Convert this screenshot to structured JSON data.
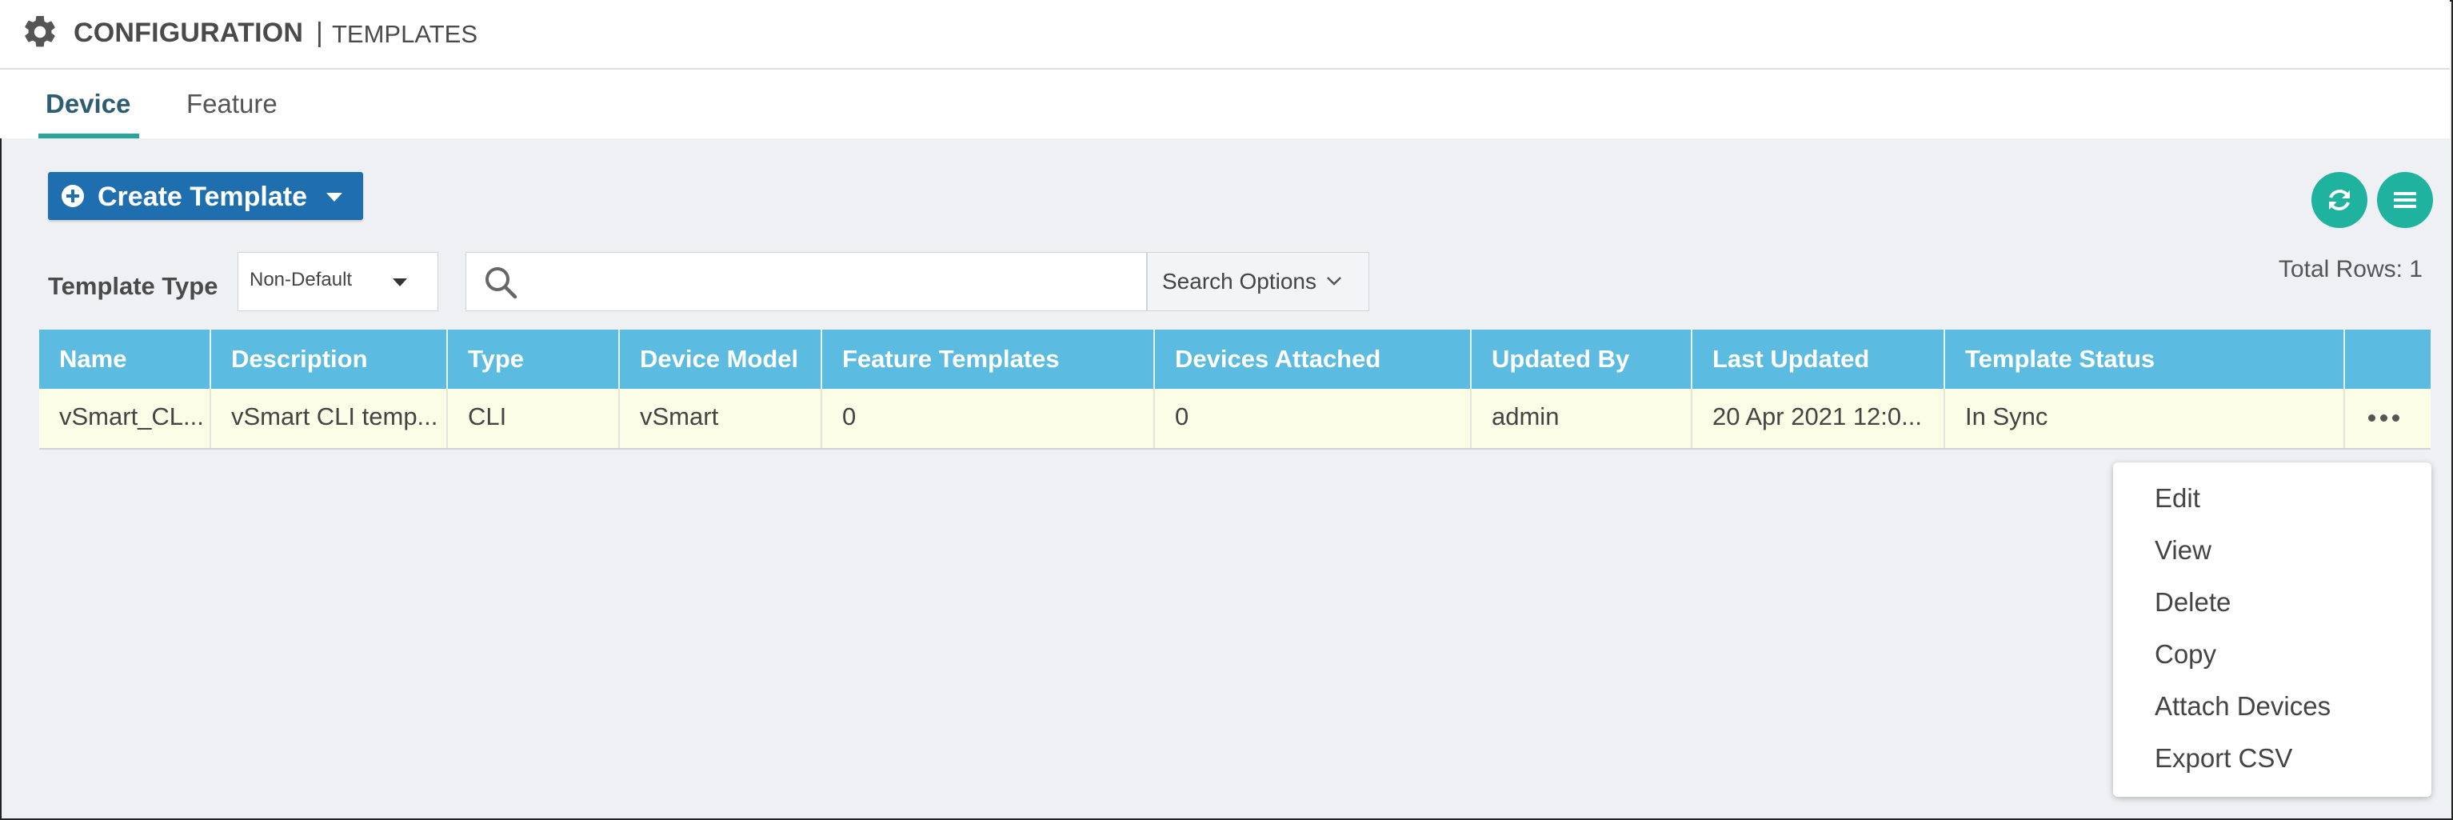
{
  "header": {
    "title": "CONFIGURATION",
    "separator": "|",
    "subtitle": "TEMPLATES"
  },
  "tabs": [
    {
      "label": "Device",
      "active": true
    },
    {
      "label": "Feature",
      "active": false
    }
  ],
  "toolbar": {
    "create_label": "Create Template",
    "total_rows_label": "Total Rows: 1"
  },
  "filters": {
    "template_type_label": "Template Type",
    "template_type_value": "Non-Default",
    "search_value": "",
    "search_options_label": "Search Options"
  },
  "table": {
    "columns": [
      "Name",
      "Description",
      "Type",
      "Device Model",
      "Feature Templates",
      "Devices Attached",
      "Updated By",
      "Last Updated",
      "Template Status",
      ""
    ],
    "rows": [
      [
        "vSmart_CL...",
        "vSmart CLI temp...",
        "CLI",
        "vSmart",
        "0",
        "0",
        "admin",
        "20 Apr 2021 12:0...",
        "In Sync"
      ]
    ]
  },
  "context_menu": {
    "items": [
      "Edit",
      "View",
      "Delete",
      "Copy",
      "Attach Devices",
      "Export CSV"
    ]
  },
  "colors": {
    "accent_teal": "#1fb29e",
    "header_blue": "#5bbbe0",
    "button_blue": "#1f6fb0",
    "row_highlight": "#fcfde6"
  },
  "icons": [
    "gear-icon",
    "plus-circle-icon",
    "caret-down-icon",
    "refresh-icon",
    "menu-icon",
    "search-icon",
    "chevron-down-icon",
    "more-horizontal-icon"
  ]
}
